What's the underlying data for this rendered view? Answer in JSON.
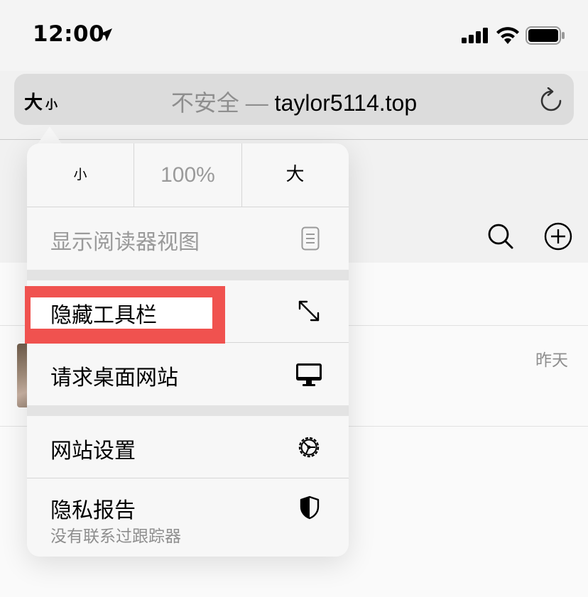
{
  "status_bar": {
    "time": "12:00"
  },
  "address_bar": {
    "text_size_big": "大",
    "text_size_small": "小",
    "security_label": "不安全",
    "dash": " — ",
    "domain": "taylor5114.top"
  },
  "popover": {
    "zoom": {
      "smaller_label": "小",
      "value": "100%",
      "larger_label": "大"
    },
    "items": [
      {
        "label": "显示阅读器视图",
        "icon": "reader-view-icon",
        "enabled": false
      },
      {
        "label": "隐藏工具栏",
        "icon": "expand-arrows-icon",
        "enabled": true
      },
      {
        "label": "请求桌面网站",
        "icon": "desktop-icon",
        "enabled": true
      },
      {
        "label": "网站设置",
        "icon": "gear-icon",
        "enabled": true
      },
      {
        "label": "隐私报告",
        "sublabel": "没有联系过跟踪器",
        "icon": "shield-icon",
        "enabled": true
      }
    ]
  },
  "background_page": {
    "date_label": "昨天"
  },
  "colors": {
    "highlight": "#f0524f",
    "disabled_text": "#9a9a9a",
    "address_bar_bg": "#dcdcdc"
  }
}
